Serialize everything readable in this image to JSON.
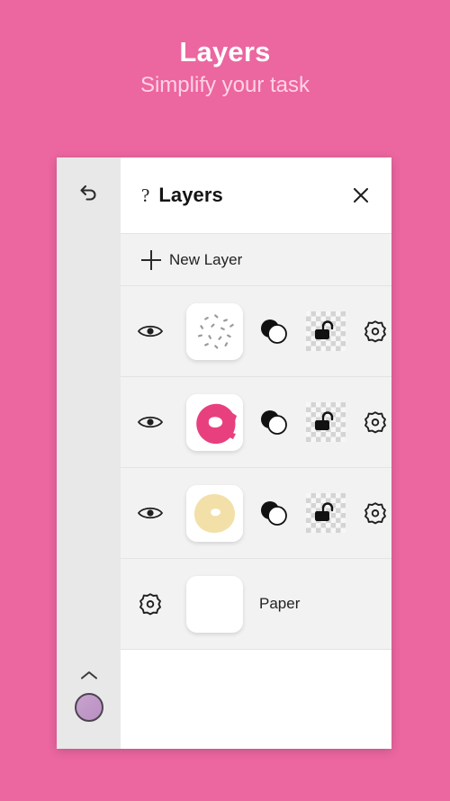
{
  "promo": {
    "title": "Layers",
    "subtitle": "Simplify your task",
    "background_color": "#ec66a0",
    "title_color": "#ffffff",
    "subtitle_color": "#ffd3e4"
  },
  "toolbar": {
    "undo_icon": "undo-arrow-icon",
    "collapse_icon": "chevron-up-icon",
    "color_swatch": {
      "icon": "color-swatch-circle",
      "color": "#b98fc2"
    }
  },
  "canvas": {
    "artwork": "pink-donut-with-sprinkles",
    "background_color": "#f0f0f0",
    "donut_color": "#e88bb4",
    "sprinkle_colors": [
      "#ffc3d9",
      "#f7a8c6",
      "#8e2545"
    ]
  },
  "panel": {
    "help_icon": "question-mark-icon",
    "title": "Layers",
    "close_icon": "close-x-icon",
    "new_layer": {
      "icon": "plus-icon",
      "label": "New Layer"
    }
  },
  "layers": [
    {
      "name": "sprinkles-layer",
      "visible": true,
      "visibility_icon": "eye-icon",
      "thumbnail": "sprinkles-thumbnail",
      "thumbnail_color": "#ffffff",
      "blend_icon": "blend-mode-circles-icon",
      "lock_icon": "unlocked-padlock-icon",
      "locked": false,
      "settings_icon": "gear-icon"
    },
    {
      "name": "frosting-layer",
      "visible": true,
      "visibility_icon": "eye-icon",
      "thumbnail": "pink-donut-thumbnail",
      "thumbnail_color": "#e8407f",
      "blend_icon": "blend-mode-circles-icon",
      "lock_icon": "unlocked-padlock-icon",
      "locked": false,
      "settings_icon": "gear-icon"
    },
    {
      "name": "donut-base-layer",
      "visible": true,
      "visibility_icon": "eye-icon",
      "thumbnail": "cream-donut-thumbnail",
      "thumbnail_color": "#f2e0a8",
      "blend_icon": "blend-mode-circles-icon",
      "lock_icon": "unlocked-padlock-icon",
      "locked": false,
      "settings_icon": "gear-icon"
    }
  ],
  "paper": {
    "settings_icon": "gear-icon",
    "thumbnail": "blank-white-thumbnail",
    "thumbnail_color": "#ffffff",
    "label": "Paper"
  }
}
